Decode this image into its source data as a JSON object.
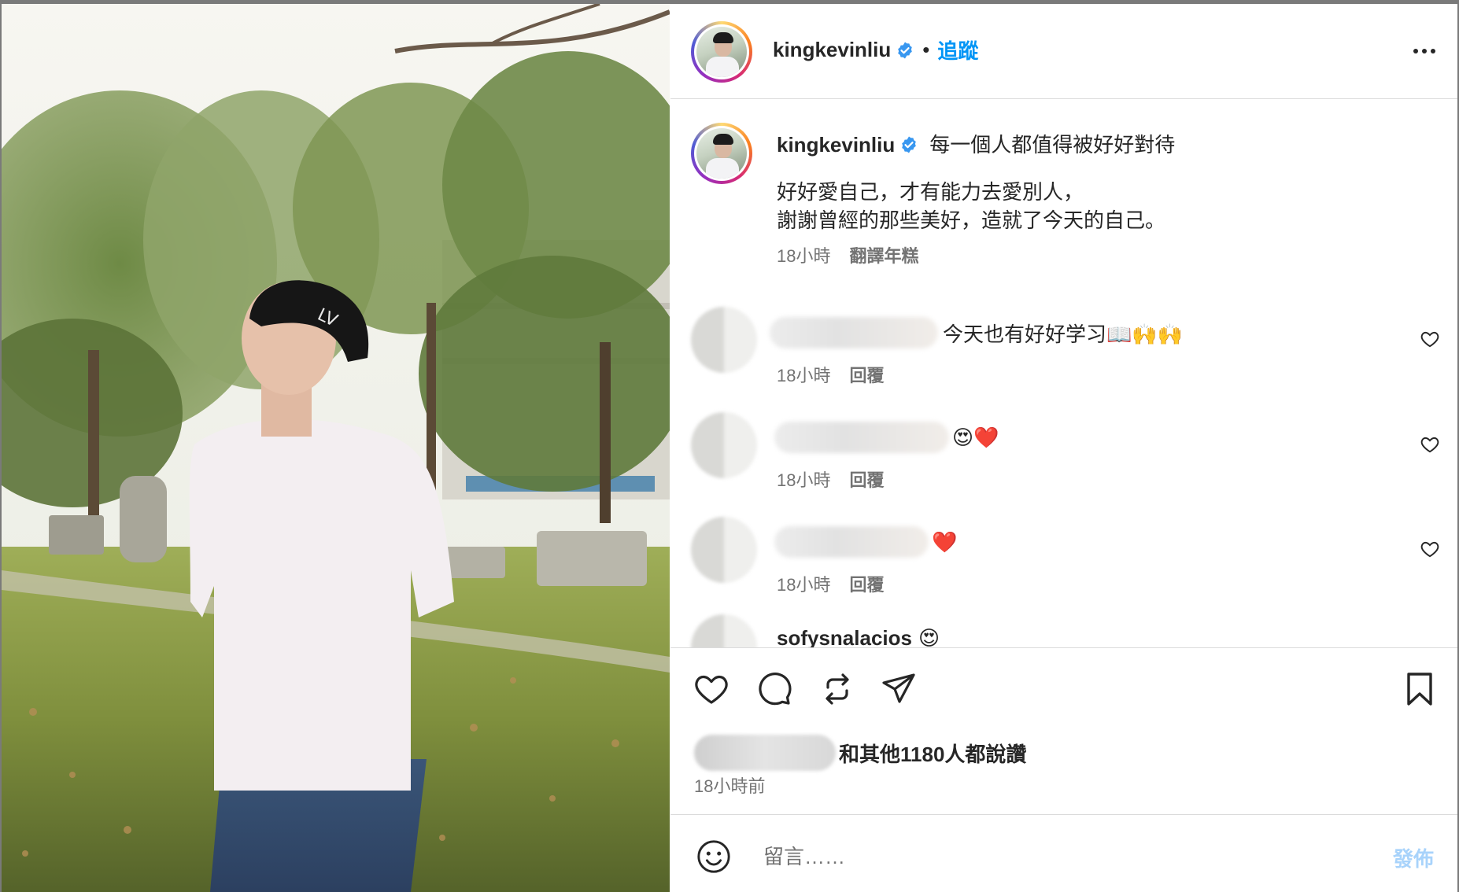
{
  "post": {
    "username": "kingkevinliu",
    "follow_label": "追蹤",
    "separator": "•",
    "more_icon": "more-horizontal-icon"
  },
  "caption": {
    "username": "kingkevinliu",
    "headline": "每一個人都值得被好好對待",
    "line1": "好好愛自己，才有能力去愛別人，",
    "line2": "謝謝曾經的那些美好，造就了今天的自己。",
    "time": "18小時",
    "translate_label": "翻譯年糕"
  },
  "comments": [
    {
      "text": "今天也有好好学习📖🙌🙌",
      "time": "18小時",
      "reply_label": "回覆"
    },
    {
      "text": "😍❤️",
      "time": "18小時",
      "reply_label": "回覆"
    },
    {
      "text": "❤️",
      "time": "18小時",
      "reply_label": "回覆"
    },
    {
      "username": "sofysnalacios",
      "text": "😍"
    }
  ],
  "likes": {
    "text": "和其他1180人都說讚",
    "time": "18小時前"
  },
  "composer": {
    "placeholder": "留言……",
    "post_label": "發佈"
  },
  "colors": {
    "link_blue": "#0095f6",
    "post_disabled": "#a8d3fb",
    "heart_red": "#ed4956",
    "verified_blue": "#3897f0"
  }
}
